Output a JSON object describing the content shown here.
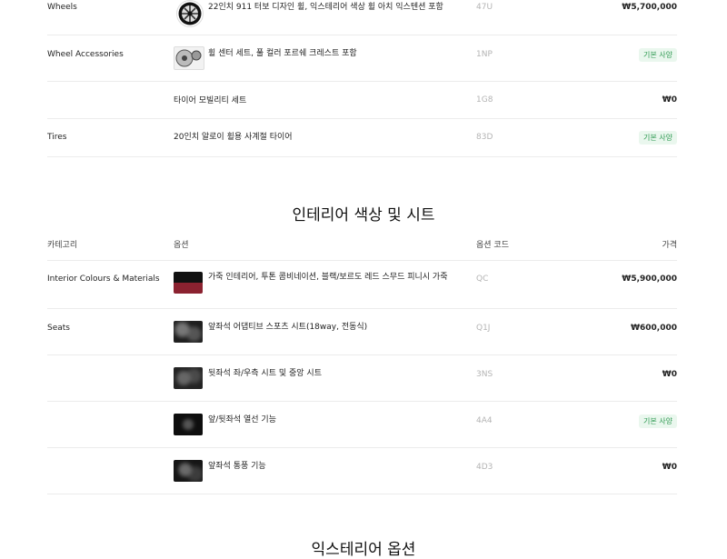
{
  "exterior_rows": [
    {
      "category": "Wheels",
      "option": "22인치 911 터보 디자인 휠, 익스테리어 색상 휠 아치 익스텐션 포함",
      "code": "47U",
      "price": "₩5,700,000",
      "badge": ""
    },
    {
      "category": "Wheel Accessories",
      "option": "휠 센터 세트, 풀 컬러 포르쉐 크레스트 포함",
      "code": "1NP",
      "price": "",
      "badge": "기본 사양"
    },
    {
      "category": "",
      "option": "타이어 모빌리티 세트",
      "code": "1G8",
      "price": "₩0",
      "badge": ""
    },
    {
      "category": "Tires",
      "option": "20인치 알로이 휠용 사계절 타이어",
      "code": "83D",
      "price": "",
      "badge": "기본 사양"
    }
  ],
  "interior": {
    "title": "인테리어 색상 및 시트",
    "headers": {
      "category": "카테고리",
      "option": "옵션",
      "code": "옵션 코드",
      "price": "가격"
    },
    "rows": [
      {
        "category": "Interior Colours & Materials",
        "option": "가죽 인테리어, 투톤 콤비네이션, 블랙/보르도 레드 스무드 피니시 가죽",
        "code": "QC",
        "price": "₩5,900,000",
        "badge": ""
      },
      {
        "category": "Seats",
        "option": "앞좌석 어댑티브 스포츠 시트(18way, 전동식)",
        "code": "Q1J",
        "price": "₩600,000",
        "badge": ""
      },
      {
        "category": "",
        "option": "뒷좌석 좌/우측 시트 및 중앙 시트",
        "code": "3NS",
        "price": "₩0",
        "badge": ""
      },
      {
        "category": "",
        "option": "앞/뒷좌석 열선 기능",
        "code": "4A4",
        "price": "",
        "badge": "기본 사양"
      },
      {
        "category": "",
        "option": "앞좌석 통풍 기능",
        "code": "4D3",
        "price": "₩0",
        "badge": ""
      }
    ]
  },
  "next_section_title": "익스테리어 옵션",
  "icons": {
    "wheel": "wheel-icon",
    "wheel_accessory": "wheel-center-icon",
    "interior_swatch": "color-swatch-icon",
    "seat": "seat-photo-icon"
  }
}
